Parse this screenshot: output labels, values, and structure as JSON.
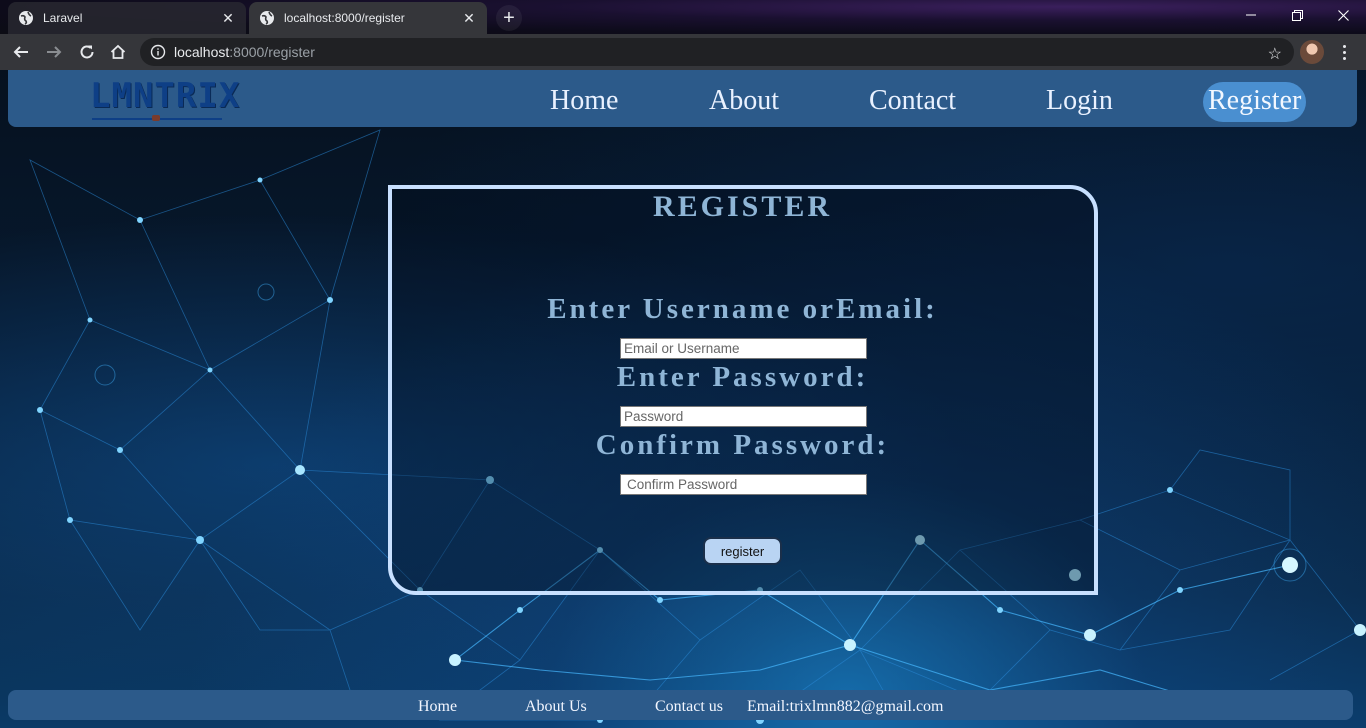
{
  "browser": {
    "tabs": [
      {
        "title": "Laravel",
        "active": false
      },
      {
        "title": "localhost:8000/register",
        "active": true
      }
    ],
    "url_host": "localhost",
    "url_path": ":8000/register"
  },
  "site": {
    "logo": "LMNTRIX",
    "nav": [
      "Home",
      "About",
      "Contact",
      "Login",
      "Register"
    ],
    "active_nav": "Register"
  },
  "form": {
    "title": "REGISTER",
    "username_label": "Enter Username orEmail:",
    "username_placeholder": "Email or Username",
    "password_label": "Enter Password:",
    "password_placeholder": "Password",
    "confirm_label": "Confirm Password:",
    "confirm_placeholder": "Confirm Password",
    "submit": "register"
  },
  "footer": {
    "home": "Home",
    "about": "About Us",
    "contact": "Contact us",
    "email": "Email:trixlmn882@gmail.com"
  },
  "colors": {
    "navbar": "#2c5a8a",
    "active_nav": "#4a8fd0",
    "form_border": "#c8e0ff",
    "label_text": "#8fb5d6"
  }
}
